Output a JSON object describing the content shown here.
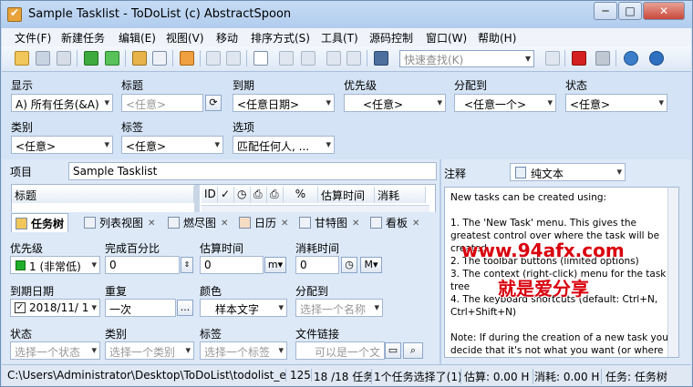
{
  "window": {
    "title": "Sample Tasklist - ToDoList (c) AbstractSpoon",
    "min": "─",
    "max": "□",
    "close": "✕"
  },
  "menu": [
    "文件(F)",
    "新建任务",
    "编辑(E)",
    "视图(V)",
    "移动",
    "排序方式(S)",
    "工具(T)",
    "源码控制",
    "窗口(W)",
    "帮助(H)"
  ],
  "toolbar": {
    "quick_find_placeholder": "快速查找(K)"
  },
  "filter": {
    "show_label": "显示",
    "show_value": "A)  所有任务(&A)",
    "title_label": "标题",
    "title_placeholder": "<任意>",
    "due_label": "到期",
    "due_value": "<任意日期>",
    "priority_label": "优先级",
    "priority_value": "<任意>",
    "assigned_label": "分配到",
    "assigned_value": "<任意一个>",
    "status_label": "状态",
    "status_value": "<任意>",
    "category_label": "类别",
    "category_value": "<任意>",
    "tag_label": "标签",
    "tag_value": "<任意>",
    "options_label": "选项",
    "options_value": "匹配任何人, ..."
  },
  "project": {
    "label": "项目",
    "value": "Sample Tasklist"
  },
  "tree": {
    "col_title": "标题",
    "cols": [
      "ID",
      "✓",
      "◷",
      "⎙",
      "⎙",
      "%",
      "估算时间",
      "消耗"
    ]
  },
  "tabs": [
    "任务树",
    "列表视图",
    "燃尽图",
    "日历",
    "甘特图",
    "看板"
  ],
  "detail": {
    "priority_label": "优先级",
    "priority_value": "1 (非常低)",
    "percent_label": "完成百分比",
    "percent_value": "0",
    "estimate_label": "估算时间",
    "estimate_value": "0",
    "estimate_unit": "m",
    "spent_label": "消耗时间",
    "spent_value": "0",
    "spent_unit": "M",
    "due_label": "到期日期",
    "due_value": "2018/11/  1",
    "recur_label": "重复",
    "recur_value": "一次",
    "recur_btn": "...",
    "color_label": "颜色",
    "color_value": "样本文字",
    "assigned_label": "分配到",
    "assigned_placeholder": "选择一个名称",
    "status_label": "状态",
    "status_placeholder": "选择一个状态",
    "category_label": "类别",
    "category_placeholder": "选择一个类别",
    "tag_label": "标签",
    "tag_placeholder": "选择一个标签",
    "file_label": "文件链接",
    "file_placeholder": "可以是一个文"
  },
  "notes": {
    "label": "注释",
    "format": "纯文本",
    "lines": [
      "New tasks can be created using:",
      "",
      "1. The 'New Task' menu. This gives the greatest control over where the task will be created",
      "2. The toolbar buttons (limited options)",
      "3. The context (right-click) menu for the task tree",
      "4. The keyboard shortcuts (default: Ctrl+N, Ctrl+Shift+N)",
      "",
      "Note: If during the creation of a new task you decide that it's not what you want (or where you want it) just hit Escape and the task creation will be cancelled."
    ]
  },
  "watermark": {
    "url": "www.94afx.com",
    "text": "就是爱分享"
  },
  "status": {
    "path": "C:\\Users\\Administrator\\Desktop\\ToDoList\\todolist_exe\\Resour",
    "count": "125",
    "tasks": "18 /18 任务",
    "selected": "1个任务选择了(1)",
    "estimate": "估算: 0.00 H",
    "spent": "消耗: 0.00 H",
    "task": "任务: 任务树"
  }
}
